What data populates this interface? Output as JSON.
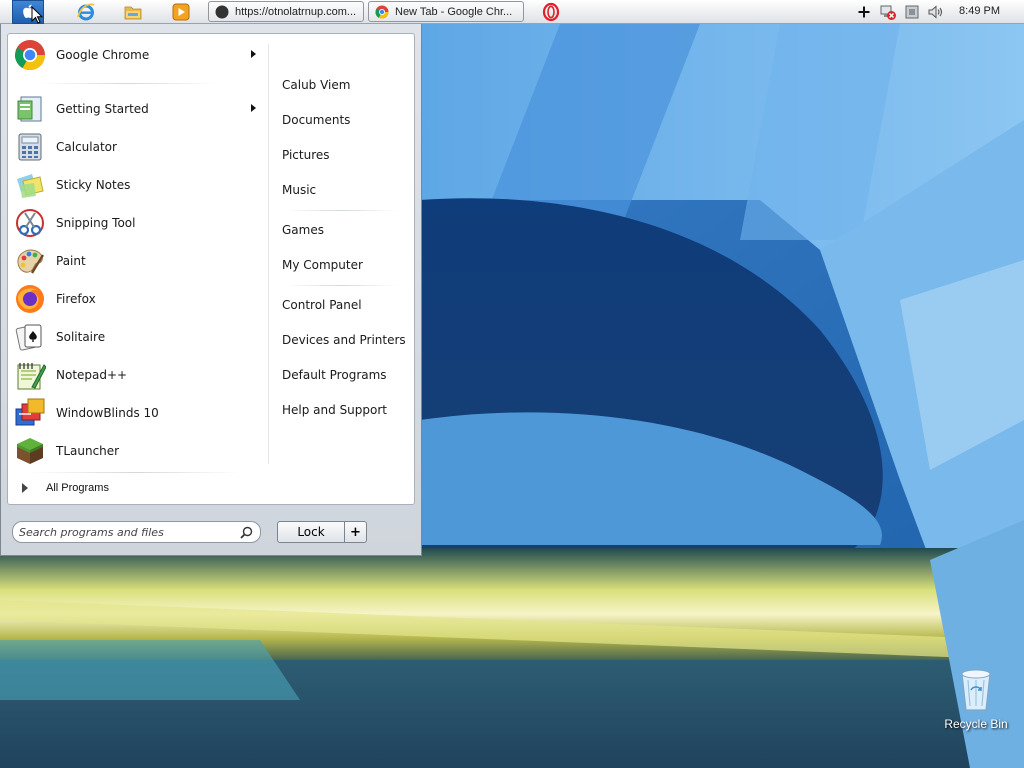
{
  "taskbar": {
    "start_button": {
      "icon": "apple-icon"
    },
    "quick_launch": [
      {
        "name": "internet-explorer",
        "icon": "ie-icon"
      },
      {
        "name": "file-explorer",
        "icon": "folder-icon"
      },
      {
        "name": "media-player",
        "icon": "media-player-icon"
      }
    ],
    "tasks": [
      {
        "label": "https://otnolatrnup.com...",
        "icon": "globe-icon"
      },
      {
        "label": "New Tab - Google Chr...",
        "icon": "chrome-icon"
      }
    ],
    "opera_icon": "opera-icon",
    "tray": {
      "icons": [
        "plus-icon",
        "network-error-icon",
        "power-icon",
        "volume-icon"
      ],
      "clock": "8:49 PM"
    }
  },
  "start_menu": {
    "pinned": [
      {
        "label": "Google Chrome",
        "icon": "chrome-icon",
        "has_submenu": true
      }
    ],
    "recent": [
      {
        "label": "Getting Started",
        "icon": "getting-started-icon",
        "has_submenu": true
      },
      {
        "label": "Calculator",
        "icon": "calculator-icon"
      },
      {
        "label": "Sticky Notes",
        "icon": "sticky-notes-icon"
      },
      {
        "label": "Snipping Tool",
        "icon": "snipping-tool-icon"
      },
      {
        "label": "Paint",
        "icon": "paint-icon"
      },
      {
        "label": "Firefox",
        "icon": "firefox-icon"
      },
      {
        "label": "Solitaire",
        "icon": "solitaire-icon"
      },
      {
        "label": "Notepad++",
        "icon": "notepad-plus-plus-icon"
      },
      {
        "label": "WindowBlinds 10",
        "icon": "windowblinds-icon"
      },
      {
        "label": "TLauncher",
        "icon": "tlauncher-icon"
      }
    ],
    "all_programs": "All Programs",
    "right_links": [
      "Calub Viem",
      "Documents",
      "Pictures",
      "Music",
      "Games",
      "My Computer",
      "Control Panel",
      "Devices and Printers",
      "Default Programs",
      "Help and Support"
    ],
    "search": {
      "placeholder": "Search programs and files"
    },
    "lock_label": "Lock",
    "lock_options_label": "+"
  },
  "desktop": {
    "icons": [
      {
        "label": "Recycle Bin",
        "icon": "recycle-bin-icon"
      }
    ]
  },
  "colors": {
    "accent": "#1f5fae",
    "wallpaper_blue": "#1d4f86"
  }
}
